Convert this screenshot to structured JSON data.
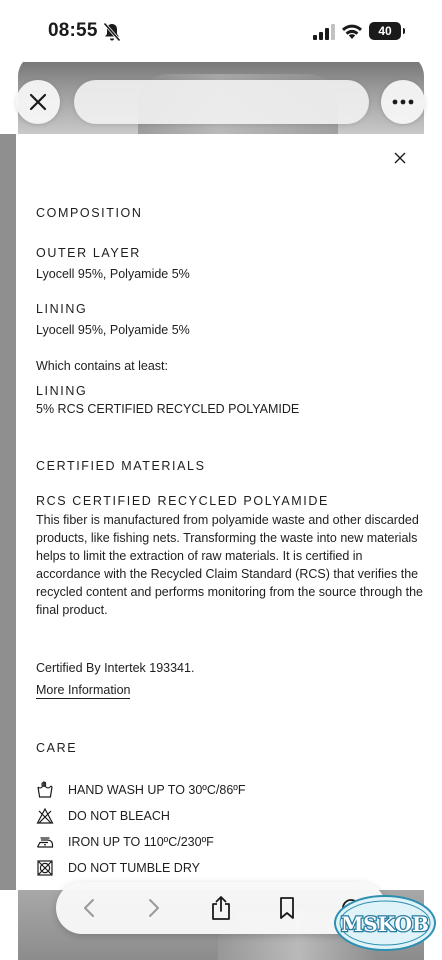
{
  "status_bar": {
    "time": "08:55",
    "battery": "40",
    "icons": [
      "bell-off-icon",
      "cellular-signal-icon",
      "wifi-icon",
      "battery-icon"
    ]
  },
  "browser": {
    "close_icon": "close-icon",
    "more_icon": "more-icon"
  },
  "panel": {
    "close_icon": "close-icon",
    "composition_heading": "COMPOSITION",
    "outer_layer_heading": "OUTER LAYER",
    "outer_layer_value": "Lyocell 95%, Polyamide 5%",
    "lining_heading": "LINING",
    "lining_value": "Lyocell 95%, Polyamide 5%",
    "contains_note": "Which contains at least:",
    "contains_lining_heading": "LINING",
    "contains_lining_value": "5% RCS CERTIFIED RECYCLED POLYAMIDE",
    "certified_heading": "CERTIFIED MATERIALS",
    "rcs_heading": "RCS CERTIFIED RECYCLED POLYAMIDE",
    "rcs_description": "This fiber is manufactured from polyamide waste and other discarded products, like fishing nets. Transforming the waste into new materials helps to limit the extraction of raw materials. It is certified in accordance with the Recycled Claim Standard (RCS) that verifies the recycled content and performs monitoring from the source through the final product.",
    "certified_by": "Certified By Intertek 193341.",
    "more_info_link": "More Information",
    "care_heading": "CARE",
    "care_items": [
      {
        "icon": "hand-wash-icon",
        "label": "HAND WASH UP TO 30ºC/86ºF"
      },
      {
        "icon": "do-not-bleach-icon",
        "label": "DO NOT BLEACH"
      },
      {
        "icon": "iron-icon",
        "label": "IRON UP TO 110ºC/230ºF"
      },
      {
        "icon": "do-not-tumble-dry-icon",
        "label": "DO NOT TUMBLE DRY"
      }
    ]
  },
  "toolbar": {
    "icons": [
      "back-icon",
      "forward-icon",
      "share-icon",
      "bookmarks-icon",
      "tabs-icon"
    ]
  },
  "watermark": {
    "text": "MSKOB"
  }
}
